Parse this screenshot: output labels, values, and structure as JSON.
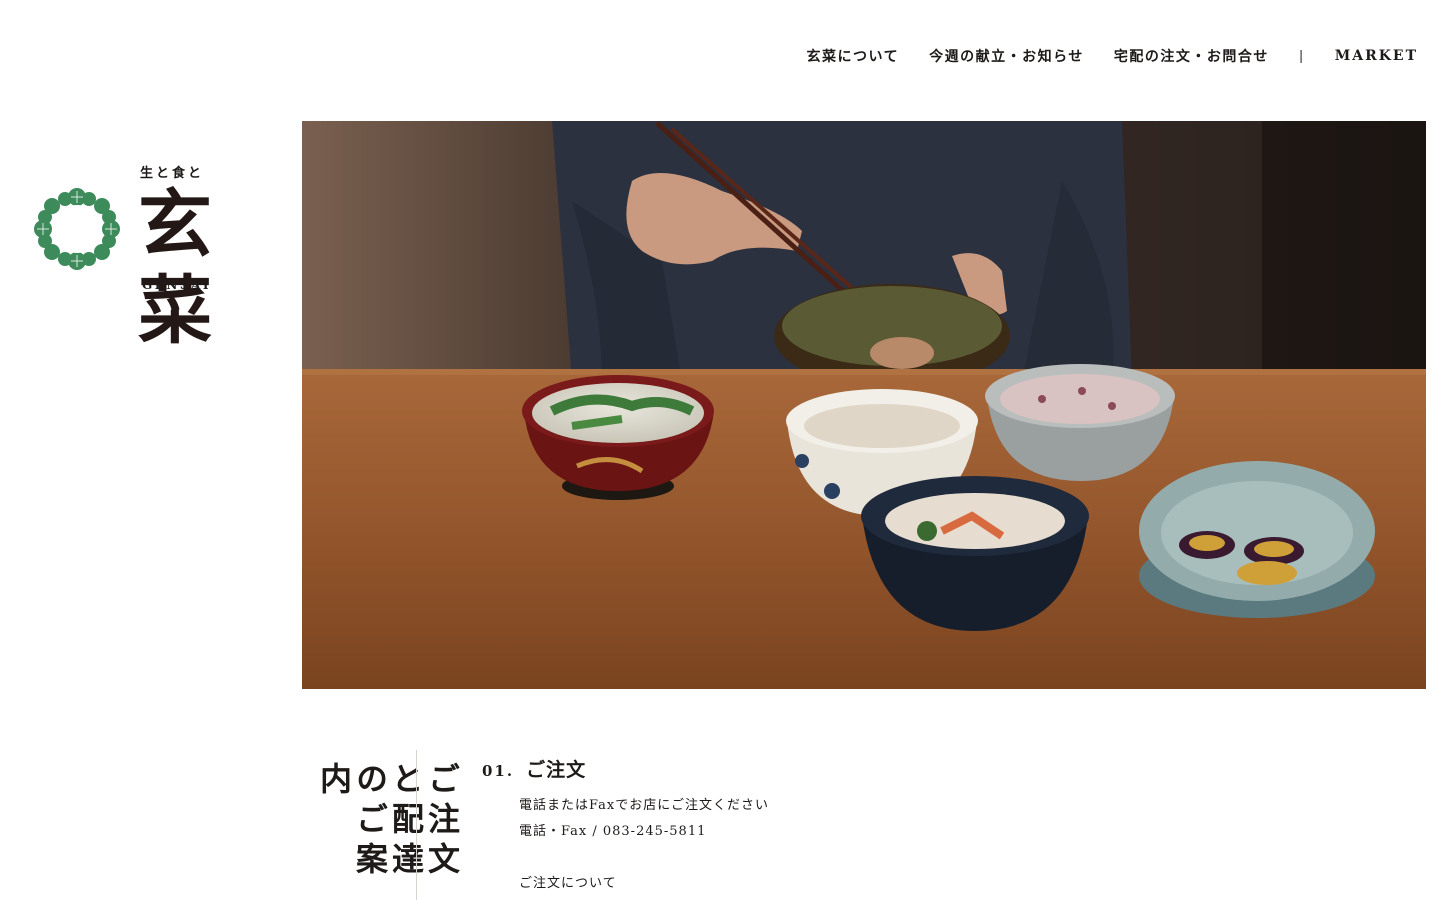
{
  "nav": {
    "items": [
      "玄菜について",
      "今週の献立・お知らせ",
      "宅配の注文・お問合せ"
    ],
    "separator": "|",
    "market": "MARKET"
  },
  "logo": {
    "tagline": "生と食と",
    "wordmark": "玄菜",
    "roman": "GENSAI",
    "mark_color": "#3d8a5a"
  },
  "section": {
    "title": "ご注文と配達のご案内",
    "number": "01.",
    "heading": "ご注文",
    "line1": "電話またはFaxでお店にご注文ください",
    "line2": "電話・Fax / 083-245-5811",
    "line3": "ご注文について"
  }
}
